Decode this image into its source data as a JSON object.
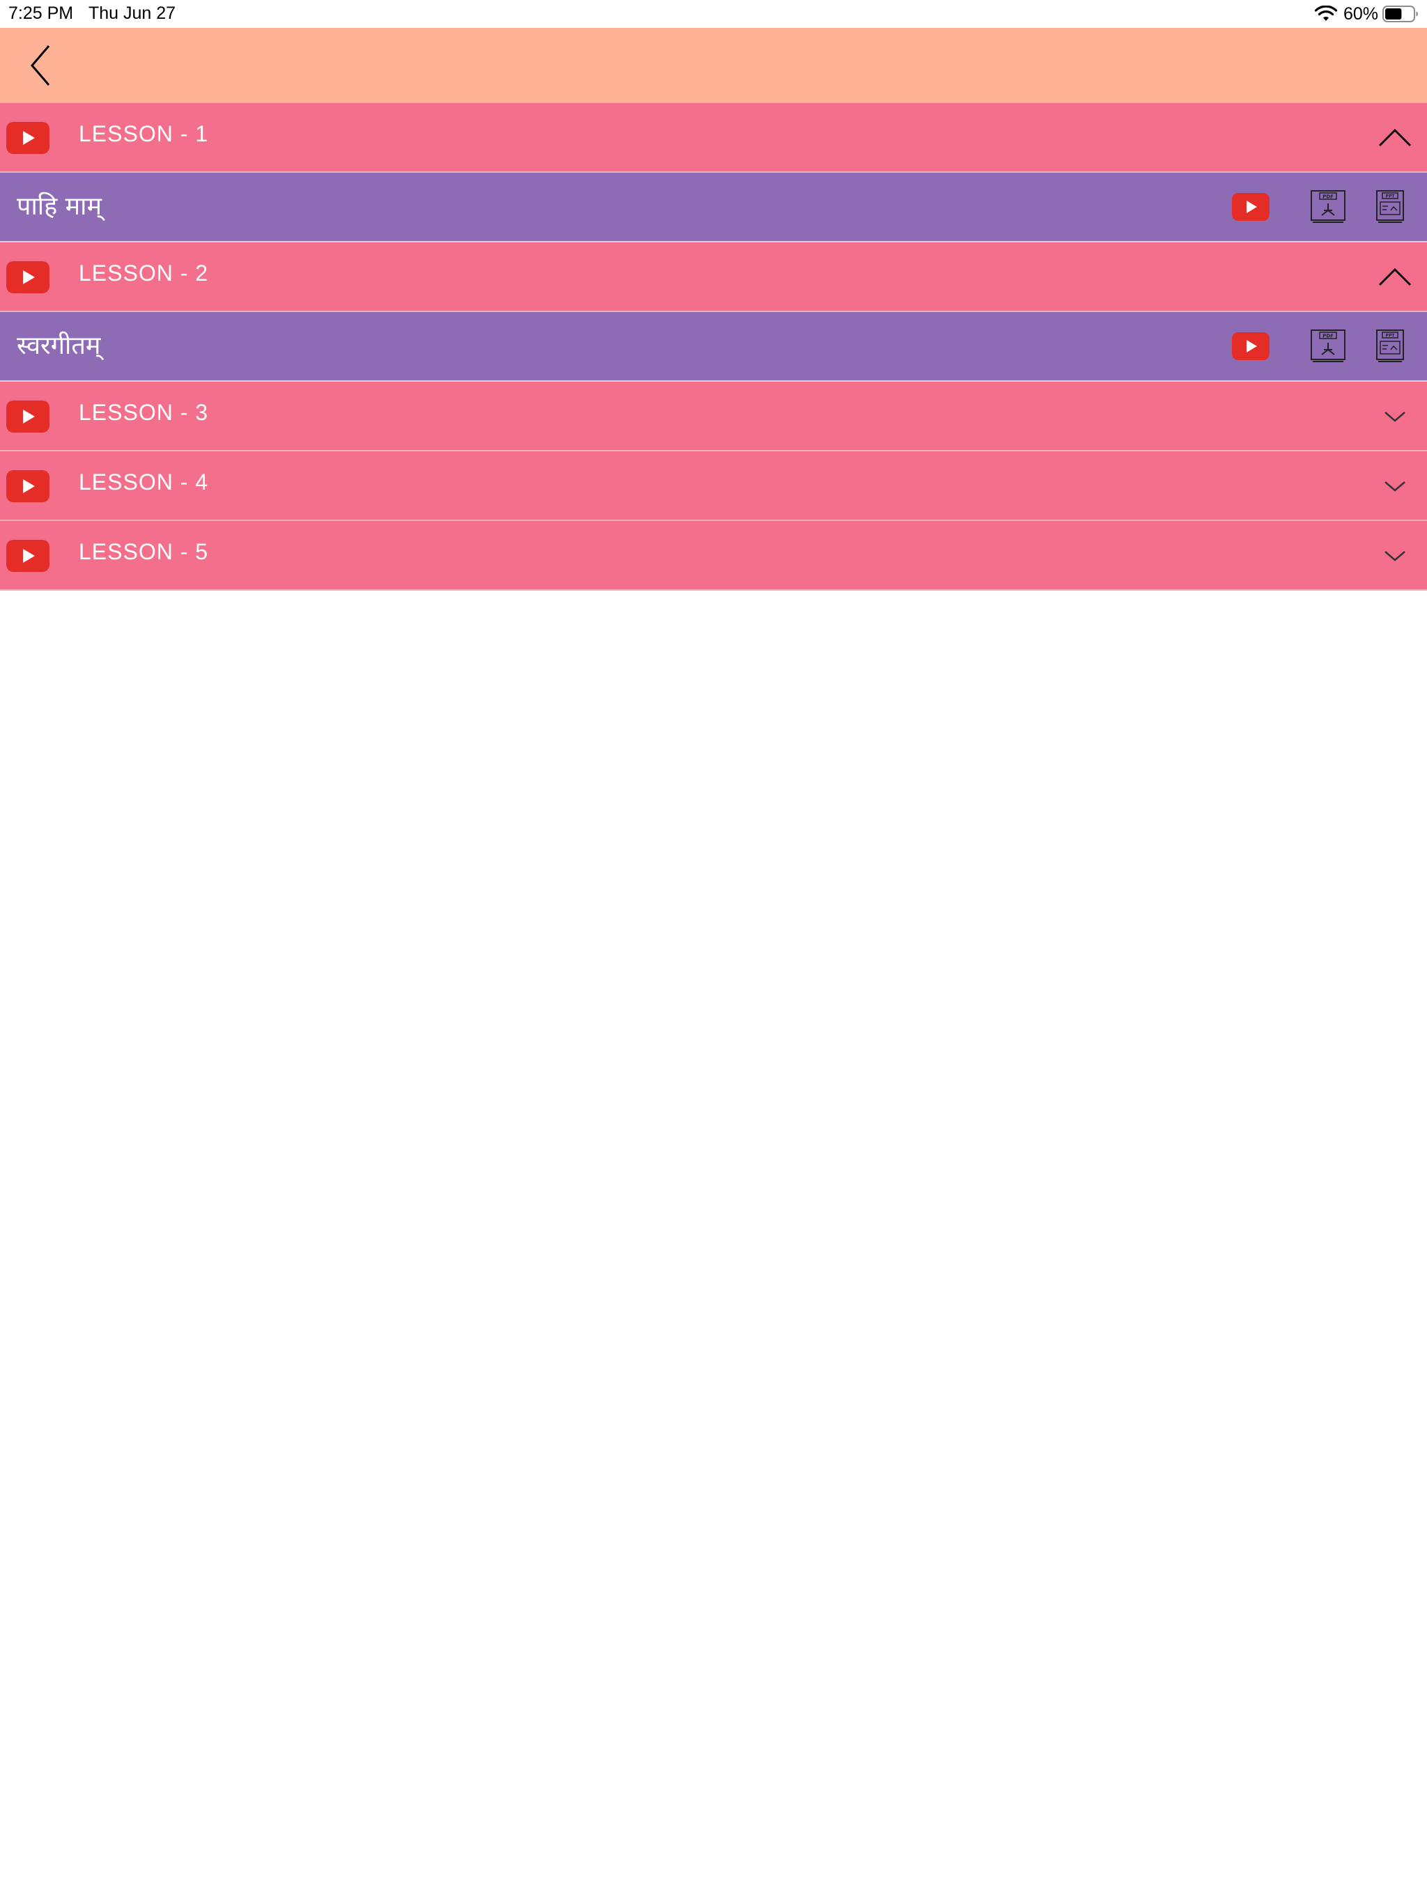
{
  "status_bar": {
    "time": "7:25 PM",
    "date": "Thu Jun 27",
    "battery_percent": "60%",
    "battery_level": 0.6
  },
  "nav": {
    "back_icon": "chevron-left-icon"
  },
  "lessons": [
    {
      "title": "LESSON - 1",
      "expanded": true,
      "toggle_icon": "chevron-up-icon",
      "items": [
        {
          "title": "पाहि माम्",
          "icons": [
            "youtube-icon",
            "pdf-icon",
            "ppt-icon"
          ]
        }
      ]
    },
    {
      "title": "LESSON - 2",
      "expanded": true,
      "toggle_icon": "chevron-up-icon",
      "items": [
        {
          "title": "स्वरगीतम्",
          "icons": [
            "youtube-icon",
            "pdf-icon",
            "ppt-icon"
          ]
        }
      ]
    },
    {
      "title": "LESSON - 3",
      "expanded": false,
      "toggle_icon": "chevron-down-icon",
      "items": []
    },
    {
      "title": "LESSON - 4",
      "expanded": false,
      "toggle_icon": "chevron-down-icon",
      "items": []
    },
    {
      "title": "LESSON - 5",
      "expanded": false,
      "toggle_icon": "chevron-down-icon",
      "items": []
    }
  ],
  "colors": {
    "nav_background": "#ffb296",
    "lesson_row": "#f36f8b",
    "sub_row": "#8d6cb5",
    "youtube_red": "#e52d27"
  }
}
